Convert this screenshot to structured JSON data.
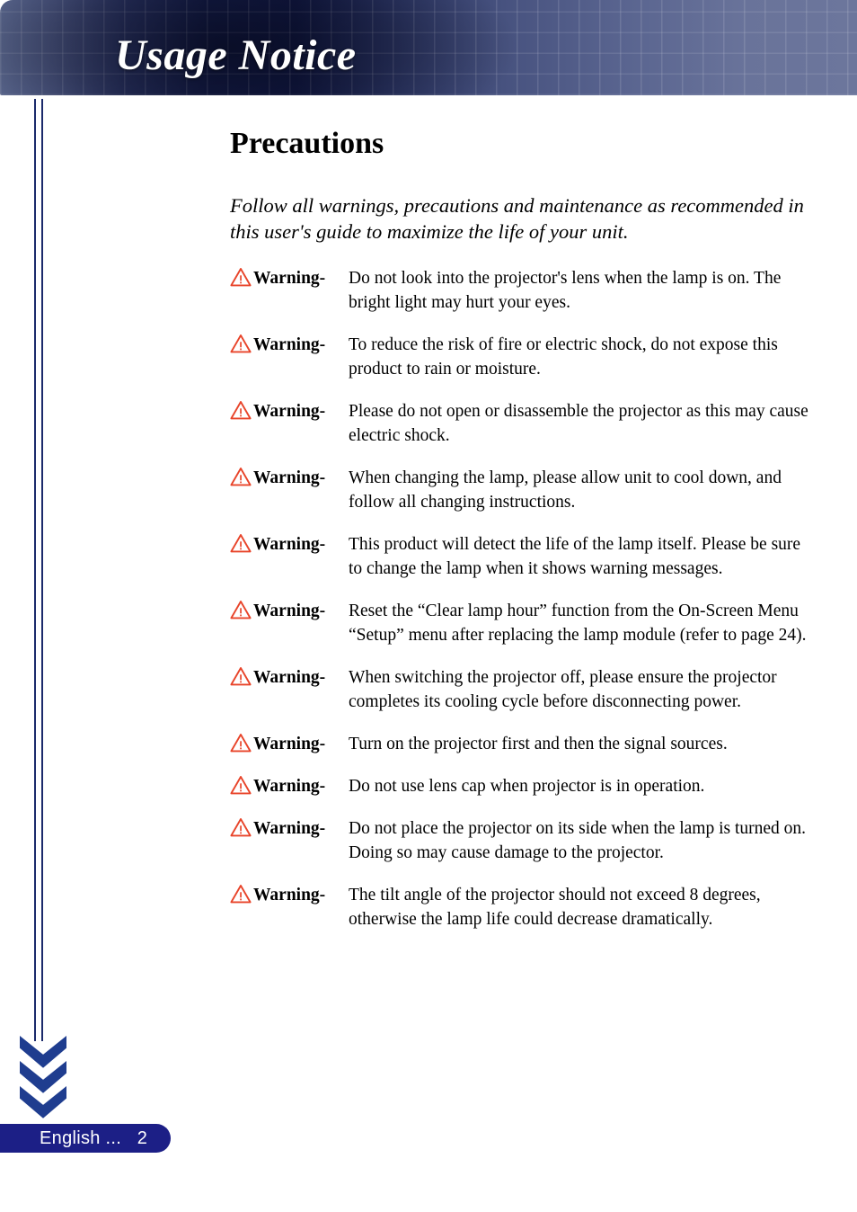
{
  "header": {
    "title": "Usage Notice"
  },
  "content": {
    "section_title": "Precautions",
    "intro": "Follow all warnings, precautions and maintenance as recommended in this user's guide to maximize the life of your unit.",
    "warning_label": "Warning-",
    "warnings": [
      {
        "label": "Warning-",
        "text": "Do not look into the projector's lens when the lamp is on.  The bright light may hurt your eyes."
      },
      {
        "label": "Warning-",
        "text": "To reduce the risk of fire or electric shock, do not expose this product to rain or moisture."
      },
      {
        "label": "Warning-",
        "text": "Please do not open or disassemble the projector as this may cause electric shock."
      },
      {
        "label": "Warning-",
        "text": "When changing the lamp, please allow unit to cool down, and follow all changing instructions."
      },
      {
        "label": "Warning-",
        "text": "This product will detect the life of the lamp itself. Please be sure to change the lamp when it shows warning messages."
      },
      {
        "label": "Warning-",
        "text": "Reset the “Clear lamp hour” function from the On-Screen Menu “Setup” menu after replacing the lamp module (refer to page 24)."
      },
      {
        "label": "Warning-",
        "text": "When switching the projector off, please ensure the projector completes its cooling cycle before disconnecting power."
      },
      {
        "label": "Warning-",
        "text": "Turn on the projector first and then the signal sources."
      },
      {
        "label": "Warning-",
        "text": "Do not use lens cap when projector is in operation."
      },
      {
        "label": "Warning-",
        "text": "Do not place the projector on its side when the lamp is turned on.  Doing so may cause damage to the projector."
      },
      {
        "label": "Warning-",
        "text": "The tilt angle of the projector should not exceed 8 degrees,  otherwise the lamp life could decrease dramatically."
      }
    ]
  },
  "footer": {
    "page_label": "English ...   2"
  },
  "colors": {
    "header_dark": "#131b48",
    "header_light": "#6c769c",
    "rule_blue": "#1b2a6b",
    "chevron_blue": "#1f3d8f",
    "pill_blue": "#1c1f86",
    "warning_orange": "#e8442a"
  }
}
